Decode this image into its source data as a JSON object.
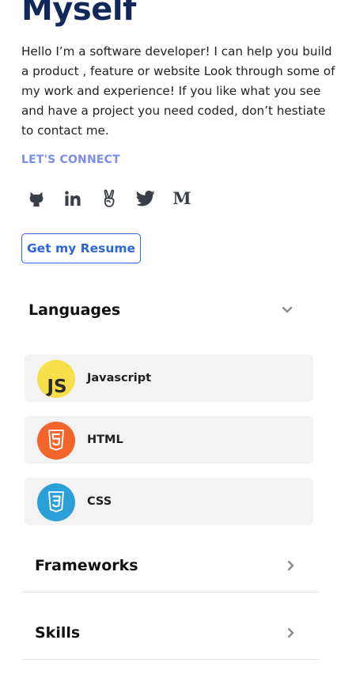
{
  "header": {
    "title": "Myself"
  },
  "bio": "Hello I’m a software developer! I can help you build a product , feature or website Look through some of my work and experience! If you like what you see and have a project you need coded, don’t hestiate to contact me.",
  "connect": {
    "label": "LET'S CONNECT",
    "links": [
      {
        "icon": "github-icon",
        "name": "GitHub"
      },
      {
        "icon": "linkedin-icon",
        "name": "LinkedIn"
      },
      {
        "icon": "angellist-icon",
        "name": "AngelList"
      },
      {
        "icon": "twitter-icon",
        "name": "Twitter"
      },
      {
        "icon": "medium-icon",
        "name": "Medium"
      }
    ]
  },
  "resume_button": "Get my Resume",
  "sections": {
    "languages": {
      "title": "Languages",
      "items": [
        {
          "label": "Javascript",
          "icon": "javascript-logo",
          "color": "#f7df4a"
        },
        {
          "label": "HTML",
          "icon": "html5-logo",
          "color": "#f1652a"
        },
        {
          "label": "CSS",
          "icon": "css3-logo",
          "color": "#2a9fd8"
        }
      ]
    },
    "frameworks": {
      "title": "Frameworks"
    },
    "skills": {
      "title": "Skills"
    }
  },
  "colors": {
    "heading": "#12275a",
    "accent": "#2f66d6",
    "connect_label": "#7b8cf0",
    "item_background": "#f3f3f4"
  }
}
